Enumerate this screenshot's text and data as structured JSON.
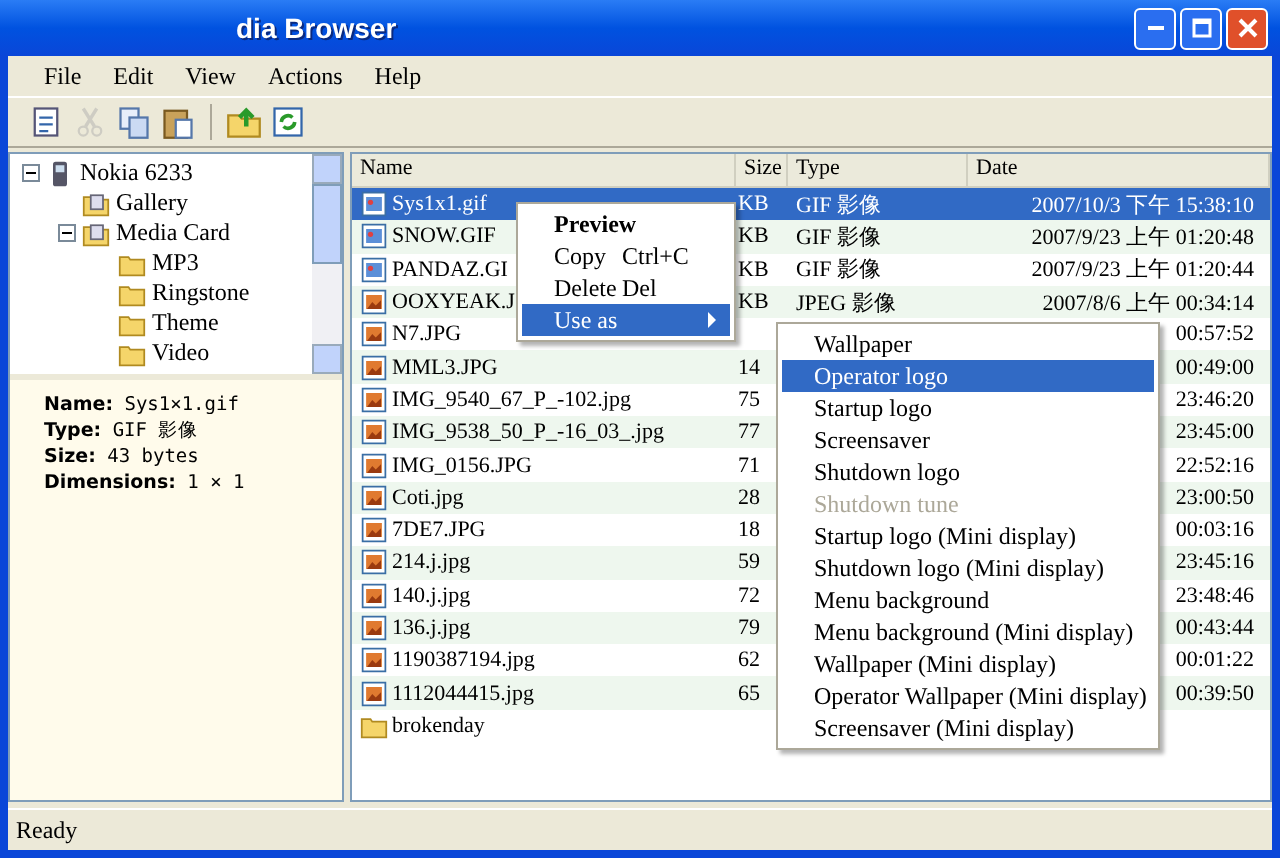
{
  "window": {
    "title": "dia Browser"
  },
  "menu_bar": [
    "File",
    "Edit",
    "View",
    "Actions",
    "Help"
  ],
  "toolbar": [
    {
      "kind": "properties",
      "disabled": false
    },
    {
      "kind": "cut",
      "disabled": true
    },
    {
      "kind": "copy",
      "disabled": false
    },
    {
      "kind": "paste",
      "disabled": false
    },
    {
      "kind": "separator"
    },
    {
      "kind": "upload",
      "disabled": false
    },
    {
      "kind": "refresh",
      "disabled": false
    }
  ],
  "tree": [
    {
      "label": "Nokia 6233",
      "kind": "phone",
      "expanded": true,
      "children": [
        {
          "label": "Gallery",
          "kind": "drive"
        },
        {
          "label": "Media Card",
          "kind": "drive",
          "expanded": true,
          "children": [
            {
              "label": "MP3",
              "kind": "folder"
            },
            {
              "label": "Ringstone",
              "kind": "folder"
            },
            {
              "label": "Theme",
              "kind": "folder"
            },
            {
              "label": "Video",
              "kind": "folder"
            }
          ]
        }
      ]
    }
  ],
  "details": [
    "**Name:** Sys1×1.gif",
    "**Type:** GIF 影像",
    "**Size:** 43 bytes",
    "**Dimensions:** 1 × 1"
  ],
  "table": {
    "columns": [
      "Name",
      "Size",
      "Type",
      "Date"
    ],
    "rows": [
      {
        "kind": "gif",
        "name": "Sys1x1.gif",
        "size": "KB",
        "type": "GIF 影像",
        "date": "2007/10/3 下午 15:38:10",
        "selected": true
      },
      {
        "kind": "gif",
        "name": "SNOW.GIF",
        "size": "KB",
        "type": "GIF 影像",
        "date": "2007/9/23 上午 01:20:48",
        "selected": false
      },
      {
        "kind": "gif",
        "name": "PANDAZ.GI",
        "size": "KB",
        "type": "GIF 影像",
        "date": "2007/9/23 上午 01:20:44",
        "selected": false
      },
      {
        "kind": "jpg",
        "name": "OOXYEAK.J",
        "size": "KB",
        "type": "JPEG 影像",
        "date": "2007/8/6 上午 00:34:14",
        "selected": false
      },
      {
        "kind": "jpg",
        "name": "N7.JPG",
        "date": "00:57:52",
        "selected": false
      },
      {
        "kind": "jpg",
        "name": "MML3.JPG",
        "size": "14",
        "date": "00:49:00",
        "selected": false
      },
      {
        "kind": "jpg",
        "name": "IMG_9540_67_P_-102.jpg",
        "size": "75",
        "date": "23:46:20",
        "selected": false
      },
      {
        "kind": "jpg",
        "name": "IMG_9538_50_P_-16_03_.jpg",
        "size": "77",
        "date": "23:45:00",
        "selected": false
      },
      {
        "kind": "jpg",
        "name": "IMG_0156.JPG",
        "size": "71",
        "date": "22:52:16",
        "selected": false
      },
      {
        "kind": "jpg",
        "name": "Coti.jpg",
        "size": "28",
        "date": "23:00:50",
        "selected": false
      },
      {
        "kind": "jpg",
        "name": "7DE7.JPG",
        "size": "18",
        "date": "00:03:16",
        "selected": false
      },
      {
        "kind": "jpg",
        "name": "214.j.jpg",
        "size": "59",
        "date": "23:45:16",
        "selected": false
      },
      {
        "kind": "jpg",
        "name": "140.j.jpg",
        "size": "72",
        "date": "23:48:46",
        "selected": false
      },
      {
        "kind": "jpg",
        "name": "136.j.jpg",
        "size": "79",
        "date": "00:43:44",
        "selected": false
      },
      {
        "kind": "jpg",
        "name": "1190387194.jpg",
        "size": "62",
        "date": "00:01:22",
        "selected": false
      },
      {
        "kind": "jpg",
        "name": "1112044415.jpg",
        "size": "65",
        "date": "00:39:50",
        "selected": false
      },
      {
        "kind": "folder",
        "name": "brokenday",
        "selected": false
      }
    ]
  },
  "context_menu": [
    {
      "label": "Preview",
      "kind": "default",
      "selected": false
    },
    {
      "label": "Copy",
      "shortcut": "Ctrl+C",
      "kind": "item",
      "selected": false
    },
    {
      "label": "Delete",
      "shortcut": "Del",
      "kind": "item",
      "selected": false
    },
    {
      "label": "Use as",
      "kind": "submenu",
      "selected": true
    }
  ],
  "submenu": [
    {
      "label": "Wallpaper",
      "selected": false,
      "disabled": false
    },
    {
      "label": "Operator logo",
      "selected": true,
      "disabled": false
    },
    {
      "label": "Startup logo",
      "selected": false,
      "disabled": false
    },
    {
      "label": "Screensaver",
      "selected": false,
      "disabled": false
    },
    {
      "label": "Shutdown logo",
      "selected": false,
      "disabled": false
    },
    {
      "label": "Shutdown tune",
      "selected": false,
      "disabled": true
    },
    {
      "label": "Startup logo (Mini display)",
      "selected": false,
      "disabled": false
    },
    {
      "label": "Shutdown logo (Mini display)",
      "selected": false,
      "disabled": false
    },
    {
      "label": "Menu background",
      "selected": false,
      "disabled": false
    },
    {
      "label": "Menu background (Mini display)",
      "selected": false,
      "disabled": false
    },
    {
      "label": "Wallpaper (Mini display)",
      "selected": false,
      "disabled": false
    },
    {
      "label": "Operator Wallpaper (Mini display)",
      "selected": false,
      "disabled": false
    },
    {
      "label": "Screensaver (Mini display)",
      "selected": false,
      "disabled": false
    }
  ],
  "status_bar": "Ready"
}
